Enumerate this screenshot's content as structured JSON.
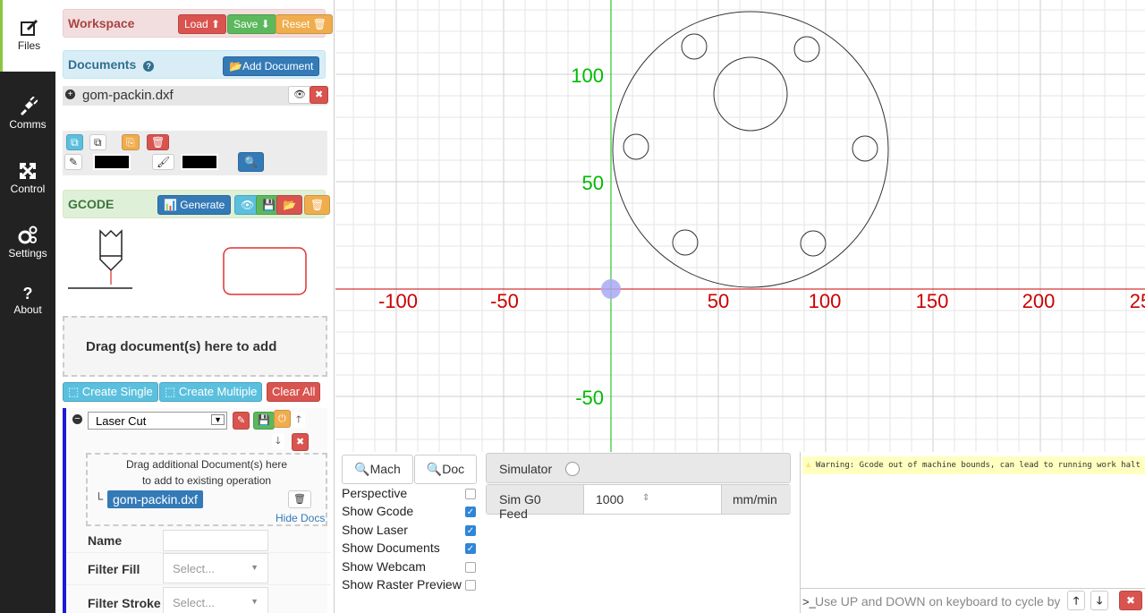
{
  "nav": {
    "files": "Files",
    "comms": "Comms",
    "control": "Control",
    "settings": "Settings",
    "about": "About",
    "about_glyph": "?"
  },
  "workspace": {
    "title": "Workspace",
    "load": "Load",
    "save": "Save",
    "reset": "Reset"
  },
  "documents": {
    "title": "Documents",
    "add": "Add Document",
    "file": "gom-packin.dxf"
  },
  "gcode": {
    "title": "GCODE",
    "generate": "Generate"
  },
  "dropzone": "Drag document(s) here to add",
  "ops": {
    "create_single": "Create Single",
    "create_multiple": "Create Multiple",
    "clear_all": "Clear All"
  },
  "operation": {
    "type": "Laser Cut",
    "drag_hint_1": "Drag additional Document(s) here",
    "drag_hint_2": "to add to existing operation",
    "doc": "gom-packin.dxf",
    "hide_docs": "Hide Docs",
    "name_label": "Name",
    "filter_fill_label": "Filter Fill",
    "filter_stroke_label": "Filter Stroke",
    "select_placeholder": "Select..."
  },
  "axes": {
    "x_labels": [
      "-100",
      "-50",
      "50",
      "100",
      "150",
      "200",
      "25"
    ],
    "y_labels": [
      "100",
      "50",
      "-50"
    ],
    "x_color": "#cc0000",
    "y_color": "#00bb00"
  },
  "view": {
    "mach": "Mach",
    "doc": "Doc",
    "options": [
      {
        "label": "Perspective",
        "checked": false
      },
      {
        "label": "Show Gcode",
        "checked": true
      },
      {
        "label": "Show Laser",
        "checked": true
      },
      {
        "label": "Show Documents",
        "checked": true
      },
      {
        "label": "Show Webcam",
        "checked": false
      },
      {
        "label": "Show Raster Preview",
        "checked": false
      }
    ]
  },
  "sim": {
    "simulator": "Simulator",
    "feed_label": "Sim G0 Feed",
    "feed_value": "1000",
    "unit": "mm/min"
  },
  "console": {
    "warning": "Warning: Gcode out of machine bounds, can lead to running work halt",
    "prompt": ">_",
    "placeholder": "Use UP and DOWN on keyboard to cycle by"
  }
}
